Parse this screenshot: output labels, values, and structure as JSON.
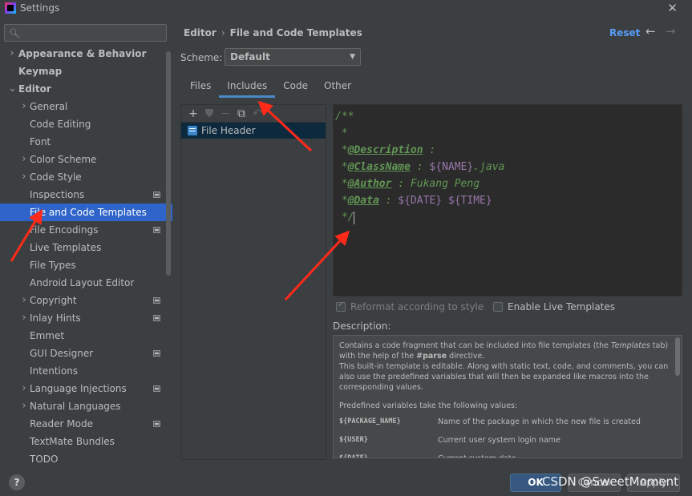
{
  "window": {
    "title": "Settings"
  },
  "search": {
    "placeholder": "",
    "value": ""
  },
  "sidebar": {
    "items": [
      {
        "label": "Appearance & Behavior",
        "level": 0,
        "expandable": true,
        "expanded": false,
        "bold": true,
        "scoped": false
      },
      {
        "label": "Keymap",
        "level": 0,
        "expandable": false,
        "bold": true,
        "scoped": false
      },
      {
        "label": "Editor",
        "level": 0,
        "expandable": true,
        "expanded": true,
        "bold": true,
        "scoped": false
      },
      {
        "label": "General",
        "level": 1,
        "expandable": true,
        "expanded": false,
        "scoped": false
      },
      {
        "label": "Code Editing",
        "level": 1,
        "expandable": false,
        "scoped": false
      },
      {
        "label": "Font",
        "level": 1,
        "expandable": false,
        "scoped": false
      },
      {
        "label": "Color Scheme",
        "level": 1,
        "expandable": true,
        "expanded": false,
        "scoped": false
      },
      {
        "label": "Code Style",
        "level": 1,
        "expandable": true,
        "expanded": false,
        "scoped": false
      },
      {
        "label": "Inspections",
        "level": 1,
        "expandable": false,
        "scoped": true
      },
      {
        "label": "File and Code Templates",
        "level": 1,
        "expandable": false,
        "scoped": false,
        "selected": true
      },
      {
        "label": "File Encodings",
        "level": 1,
        "expandable": false,
        "scoped": true
      },
      {
        "label": "Live Templates",
        "level": 1,
        "expandable": false,
        "scoped": false
      },
      {
        "label": "File Types",
        "level": 1,
        "expandable": false,
        "scoped": false
      },
      {
        "label": "Android Layout Editor",
        "level": 1,
        "expandable": false,
        "scoped": false
      },
      {
        "label": "Copyright",
        "level": 1,
        "expandable": true,
        "expanded": false,
        "scoped": true
      },
      {
        "label": "Inlay Hints",
        "level": 1,
        "expandable": true,
        "expanded": false,
        "scoped": true
      },
      {
        "label": "Emmet",
        "level": 1,
        "expandable": false,
        "scoped": false
      },
      {
        "label": "GUI Designer",
        "level": 1,
        "expandable": false,
        "scoped": true
      },
      {
        "label": "Intentions",
        "level": 1,
        "expandable": false,
        "scoped": false
      },
      {
        "label": "Language Injections",
        "level": 1,
        "expandable": true,
        "expanded": false,
        "scoped": true
      },
      {
        "label": "Natural Languages",
        "level": 1,
        "expandable": true,
        "expanded": false,
        "scoped": false
      },
      {
        "label": "Reader Mode",
        "level": 1,
        "expandable": false,
        "scoped": true
      },
      {
        "label": "TextMate Bundles",
        "level": 1,
        "expandable": false,
        "scoped": false
      },
      {
        "label": "TODO",
        "level": 1,
        "expandable": false,
        "scoped": false
      }
    ]
  },
  "header": {
    "breadcrumb_parent": "Editor",
    "breadcrumb_separator": "›",
    "breadcrumb_current": "File and Code Templates",
    "reset_label": "Reset",
    "back_icon": "←",
    "forward_icon": "→"
  },
  "scheme": {
    "label": "Scheme:",
    "value": "Default"
  },
  "tabs": [
    {
      "label": "Files",
      "active": false
    },
    {
      "label": "Includes",
      "active": true
    },
    {
      "label": "Code",
      "active": false
    },
    {
      "label": "Other",
      "active": false
    }
  ],
  "templates": {
    "items": [
      {
        "label": "File Header"
      }
    ]
  },
  "editor": {
    "lines": [
      {
        "parts": [
          {
            "t": "/**",
            "c": "comment"
          }
        ]
      },
      {
        "parts": [
          {
            "t": " *",
            "c": "comment"
          }
        ]
      },
      {
        "parts": [
          {
            "t": " *",
            "c": "comment"
          },
          {
            "t": "@Description",
            "c": "tag"
          },
          {
            "t": " :",
            "c": "comment"
          }
        ]
      },
      {
        "parts": [
          {
            "t": " *",
            "c": "comment"
          },
          {
            "t": "@ClassName",
            "c": "tag"
          },
          {
            "t": " : ",
            "c": "comment"
          },
          {
            "t": "${NAME}",
            "c": "var"
          },
          {
            "t": ".java",
            "c": "comment"
          }
        ]
      },
      {
        "parts": [
          {
            "t": " *",
            "c": "comment"
          },
          {
            "t": "@Author",
            "c": "tag"
          },
          {
            "t": " : Fukang Peng",
            "c": "comment"
          }
        ]
      },
      {
        "parts": [
          {
            "t": " *",
            "c": "comment"
          },
          {
            "t": "@Data",
            "c": "tag"
          },
          {
            "t": " : ",
            "c": "comment"
          },
          {
            "t": "${DATE}",
            "c": "var"
          },
          {
            "t": " ",
            "c": "comment"
          },
          {
            "t": "${TIME}",
            "c": "var"
          }
        ]
      },
      {
        "parts": [
          {
            "t": " */",
            "c": "comment"
          }
        ],
        "cursor": true
      }
    ]
  },
  "options": {
    "reformat_label": "Reformat according to style",
    "reformat_checked": true,
    "live_templates_label": "Enable Live Templates",
    "live_templates_checked": false
  },
  "description": {
    "label": "Description:",
    "para1_a": "Contains a code fragment that can be included into file templates (the ",
    "para1_templates": "Templates",
    "para1_b": " tab) with the help of the ",
    "para1_parse": "#parse",
    "para1_c": " directive.",
    "para2": "This built-in template is editable. Along with static text, code, and comments, you can also use the predefined variables that will then be expanded like macros into the corresponding values.",
    "para3": "Predefined variables take the following values:",
    "variables": [
      {
        "name": "${PACKAGE_NAME}",
        "desc": "Name of the package in which the new file is created"
      },
      {
        "name": "${USER}",
        "desc": "Current user system login name"
      },
      {
        "name": "${DATE}",
        "desc": "Current system date"
      }
    ]
  },
  "footer": {
    "help_label": "?",
    "ok_label": "OK",
    "cancel_label": "Cancel",
    "apply_label": "Apply",
    "watermark": "CSDN @SweetMoment"
  },
  "colors": {
    "background": "#3c3f41",
    "selection": "#2f65ca",
    "editor_bg": "#2b2b2b",
    "comment": "#629755",
    "variable": "#9876aa",
    "link": "#589df6",
    "annotation_arrow": "#ff2a1a"
  }
}
